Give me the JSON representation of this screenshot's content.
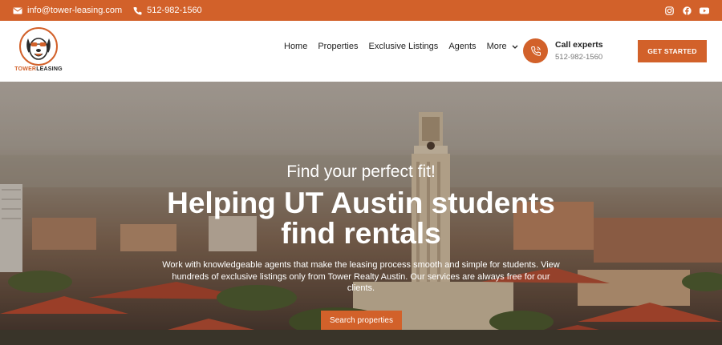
{
  "topbar": {
    "email": "info@tower-leasing.com",
    "phone": "512-982-1560",
    "social": [
      "instagram-icon",
      "facebook-icon",
      "youtube-icon"
    ]
  },
  "logo": {
    "word_a": "TOWER",
    "word_b": "LEASING"
  },
  "nav": {
    "items": [
      "Home",
      "Properties",
      "Exclusive Listings",
      "Agents",
      "More"
    ]
  },
  "call": {
    "title": "Call experts",
    "phone": "512-982-1560"
  },
  "cta": {
    "label": "GET STARTED"
  },
  "hero": {
    "kicker": "Find your perfect fit!",
    "headline": "Helping UT Austin students find rentals",
    "subtext": "Work with knowledgeable agents that make the leasing process smooth and simple for students. View hundreds of exclusive listings only from Tower Realty Austin. Our services are always free for our clients.",
    "button": "Search properties"
  },
  "colors": {
    "accent": "#d2612a",
    "text_dark": "#222222",
    "text_muted": "#777777"
  }
}
